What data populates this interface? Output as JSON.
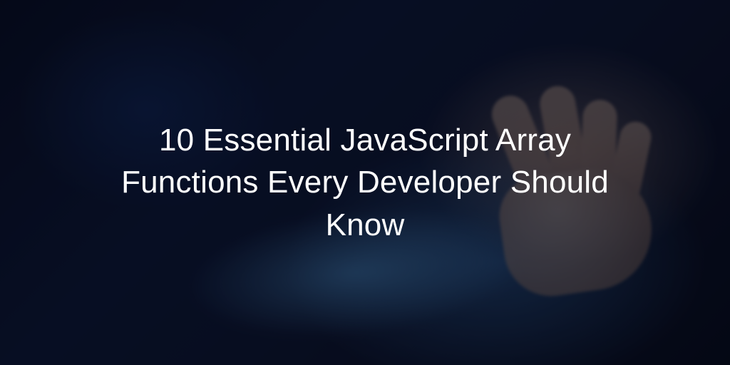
{
  "hero": {
    "title": "10 Essential JavaScript Array Functions Every Developer Should Know"
  }
}
